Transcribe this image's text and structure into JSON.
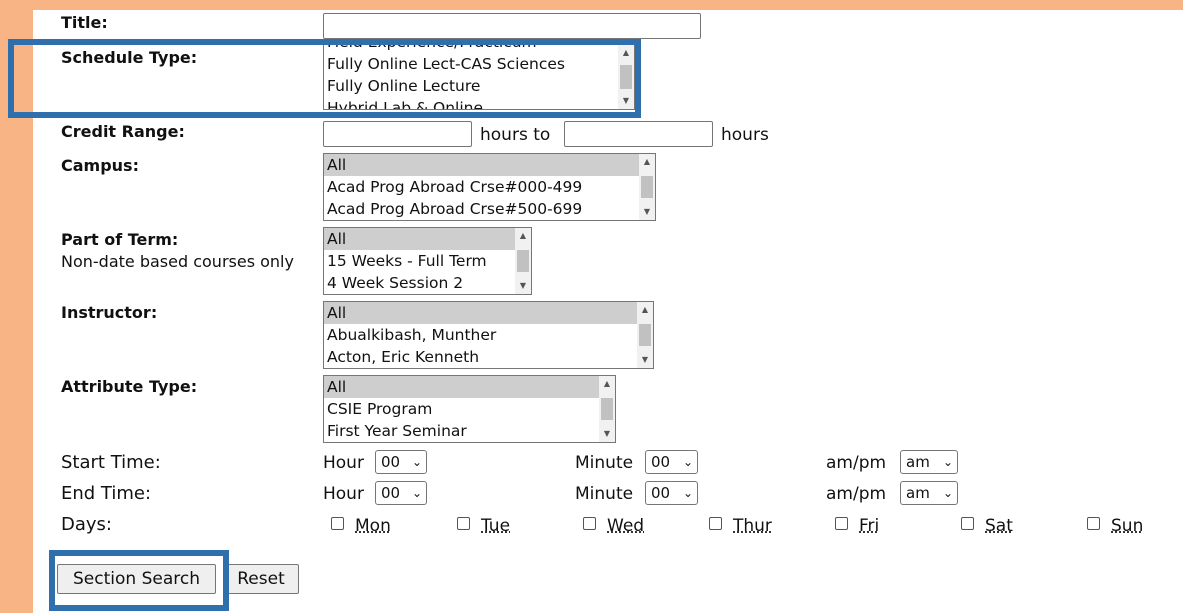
{
  "form": {
    "title_label": "Title:",
    "title_value": "",
    "schedule_type_label": "Schedule Type:",
    "schedule_type_options": [
      "Field Experience/Practicum",
      "Fully Online Lect-CAS Sciences",
      "Fully Online Lecture",
      "Hybrid Lab & Online"
    ],
    "credit_range_label": "Credit Range:",
    "credit_from": "",
    "credit_hours_to": "hours to",
    "credit_to": "",
    "credit_hours": "hours",
    "campus_label": "Campus:",
    "campus_options": [
      "All",
      "Acad Prog Abroad Crse#000-499",
      "Acad Prog Abroad Crse#500-699"
    ],
    "part_of_term_label": "Part of Term:",
    "part_of_term_note": "Non-date based courses only",
    "part_of_term_options": [
      "All",
      "15 Weeks - Full Term",
      "4 Week Session 2"
    ],
    "instructor_label": "Instructor:",
    "instructor_options": [
      "All",
      "Abualkibash, Munther",
      "Acton, Eric Kenneth"
    ],
    "attribute_type_label": "Attribute Type:",
    "attribute_type_options": [
      "All",
      "CSIE Program",
      "First Year Seminar"
    ],
    "start_time_label": "Start Time:",
    "end_time_label": "End Time:",
    "hour_label": "Hour",
    "minute_label": "Minute",
    "ampm_label": "am/pm",
    "start_hour": "00",
    "start_minute": "00",
    "start_ampm": "am",
    "end_hour": "00",
    "end_minute": "00",
    "end_ampm": "am",
    "days_label": "Days:",
    "days": [
      "Mon",
      "Tue",
      "Wed",
      "Thur",
      "Fri",
      "Sat",
      "Sun"
    ],
    "section_search_button": "Section Search",
    "reset_button": "Reset"
  },
  "colors": {
    "background": "#f9b485",
    "highlight": "#2f6fad",
    "selected_option": "#cecece"
  }
}
